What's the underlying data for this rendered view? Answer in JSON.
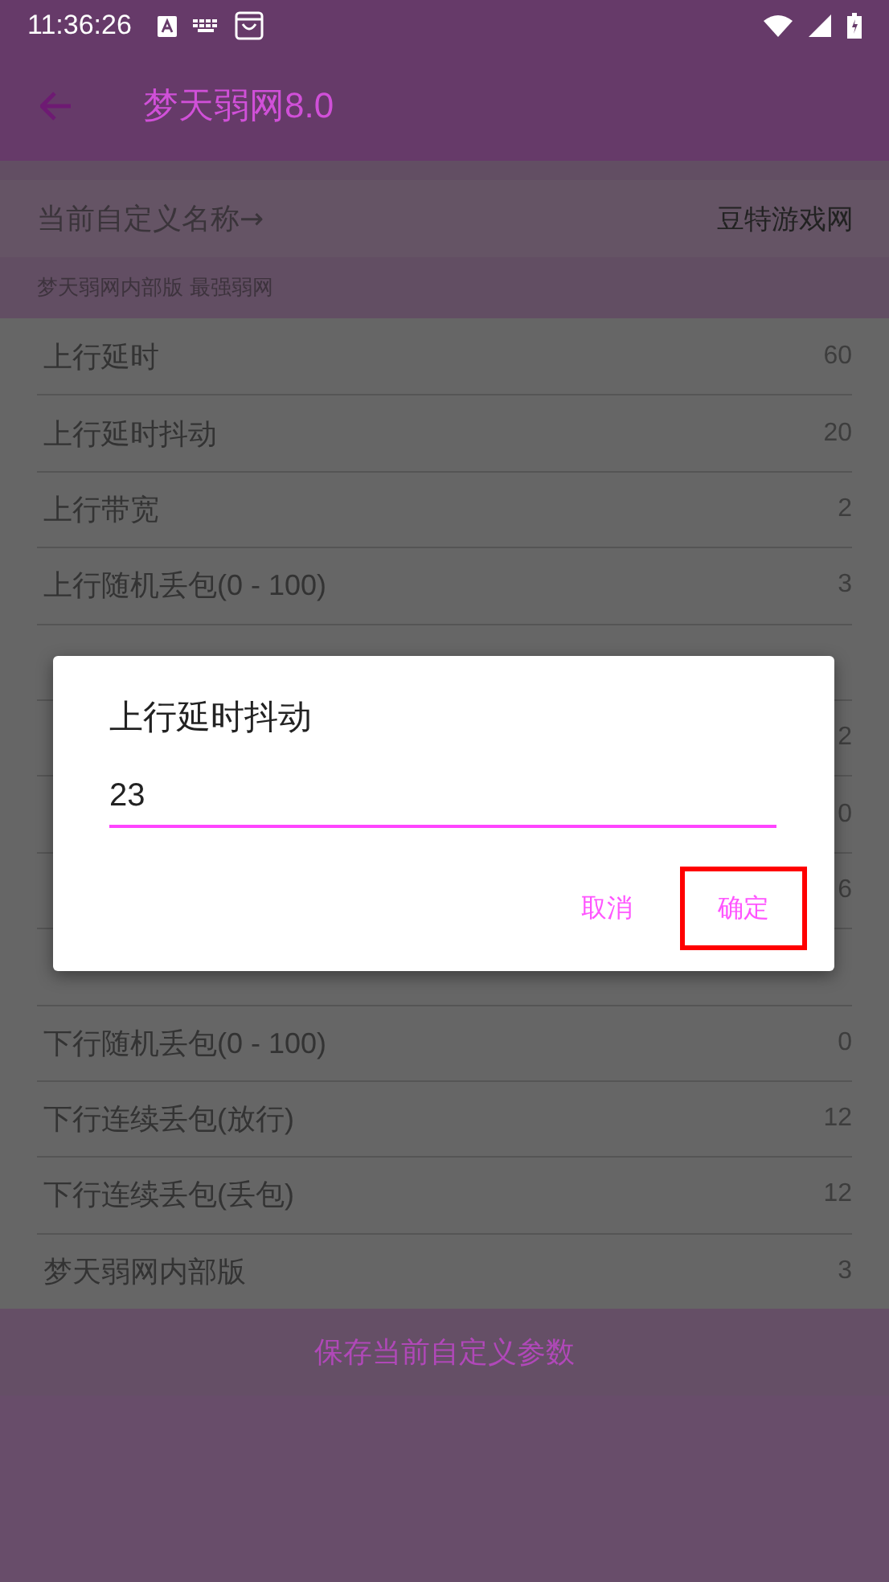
{
  "status_bar": {
    "time": "11:36:26"
  },
  "toolbar": {
    "title": "梦天弱网8.0"
  },
  "profile": {
    "label": "当前自定义名称→",
    "value": "豆特游戏网"
  },
  "subtitle": "梦天弱网内部版  最强弱网",
  "rows": [
    {
      "label": "上行延时",
      "value": "60"
    },
    {
      "label": "上行延时抖动",
      "value": "20"
    },
    {
      "label": "上行带宽",
      "value": "2"
    },
    {
      "label": "上行随机丢包(0 - 100)",
      "value": "3"
    },
    {},
    {
      "value": "2"
    },
    {
      "value": "0"
    },
    {
      "value": "6"
    },
    {},
    {
      "label": "下行随机丢包(0 - 100)",
      "value": "0"
    },
    {
      "label": "下行连续丢包(放行)",
      "value": "12"
    },
    {
      "label": "下行连续丢包(丢包)",
      "value": "12"
    },
    {
      "label": "梦天弱网内部版",
      "value": "3"
    }
  ],
  "save_button": "保存当前自定义参数",
  "dialog": {
    "title": "上行延时抖动",
    "value": "23",
    "buttons": [
      {
        "label": "取消",
        "highlighted": false
      },
      {
        "label": "确定",
        "highlighted": true
      }
    ]
  }
}
